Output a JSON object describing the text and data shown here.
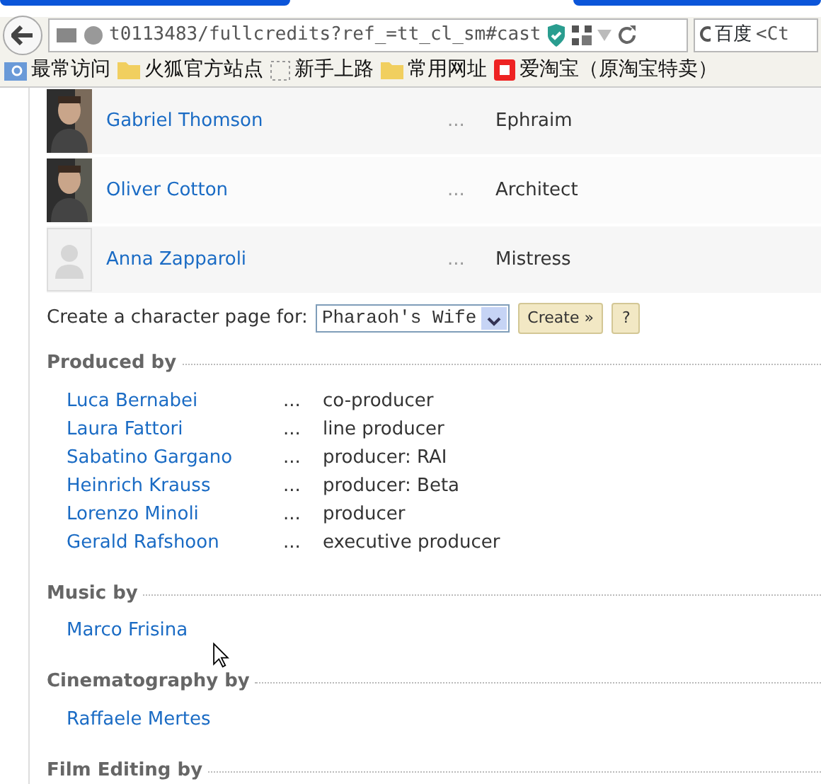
{
  "browser": {
    "url": "t0113483/fullcredits?ref_=tt_cl_sm#cast",
    "search_engine": "百度",
    "search_placeholder": "<Ct"
  },
  "bookmarks": [
    {
      "label": "最常访问",
      "kind": "smart"
    },
    {
      "label": "火狐官方站点",
      "kind": "folder"
    },
    {
      "label": "新手上路",
      "kind": "page"
    },
    {
      "label": "常用网址",
      "kind": "folder"
    },
    {
      "label": "爱淘宝（原淘宝特卖）",
      "kind": "shop"
    }
  ],
  "cast": [
    {
      "name": "Gabriel Thomson",
      "dots": "...",
      "role": "Ephraim",
      "kind": "picture"
    },
    {
      "name": "Oliver Cotton",
      "dots": "...",
      "role": "Architect",
      "kind": "picture"
    },
    {
      "name": "Anna Zapparoli",
      "dots": "...",
      "role": "Mistress",
      "kind": "placeholder"
    }
  ],
  "character_page": {
    "label": "Create a character page for:",
    "selected_option": "Pharaoh's Wife",
    "create_button": "Create »",
    "help_button": "?"
  },
  "sections": [
    {
      "title": "Produced by",
      "credits": [
        {
          "name": "Luca Bernabei",
          "dots": "...",
          "role": "co-producer"
        },
        {
          "name": "Laura Fattori",
          "dots": "...",
          "role": "line producer"
        },
        {
          "name": "Sabatino Gargano",
          "dots": "...",
          "role": "producer: RAI"
        },
        {
          "name": "Heinrich Krauss",
          "dots": "...",
          "role": "producer: Beta"
        },
        {
          "name": "Lorenzo Minoli",
          "dots": "...",
          "role": "producer"
        },
        {
          "name": "Gerald Rafshoon",
          "dots": "...",
          "role": "executive producer"
        }
      ]
    },
    {
      "title": "Music by",
      "credits": [
        {
          "name": "Marco Frisina"
        }
      ]
    },
    {
      "title": "Cinematography by",
      "credits": [
        {
          "name": "Raffaele Mertes"
        }
      ]
    },
    {
      "title": "Film Editing by"
    }
  ]
}
